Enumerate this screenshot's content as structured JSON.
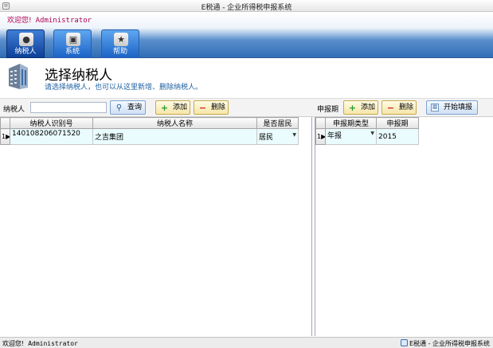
{
  "window": {
    "title": "E税通 - 企业所得税申报系统"
  },
  "banner": {
    "welcome": "欢迎您!",
    "user": "Administrator"
  },
  "nav": {
    "tabs": [
      {
        "label": "纳税人",
        "active": true
      },
      {
        "label": "系统",
        "active": false
      },
      {
        "label": "帮助",
        "active": false
      }
    ]
  },
  "page": {
    "title": "选择纳税人",
    "description": "请选择纳税人，也可以从这里新增、删除纳税人。"
  },
  "toolbar": {
    "taxpayer_label": "纳税人",
    "search_value": "",
    "search_label": "查询",
    "add_label": "添加",
    "delete_label": "删除",
    "period_label": "申报期",
    "period_add_label": "添加",
    "period_delete_label": "删除",
    "start_label": "开始填报"
  },
  "taxpayer_grid": {
    "columns": [
      "纳税人识别号",
      "纳税人名称",
      "是否居民"
    ],
    "rows": [
      {
        "marker": "1▶",
        "id": "140108206071520",
        "name": "之吉集团",
        "resident": "居民"
      }
    ]
  },
  "period_grid": {
    "columns": [
      "申报期类型",
      "申报期"
    ],
    "rows": [
      {
        "marker": "1▶",
        "type": "年报",
        "period": "2015"
      }
    ]
  },
  "status": {
    "welcome": "欢迎您!",
    "user": "Administrator",
    "app_name": "E税通 - 企业所得税申报系统"
  },
  "colors": {
    "banner_blue": "#2f6db7",
    "welcome_text": "#b00050",
    "grid_row": "#eafcfe",
    "button_yellow": "#f5e6a8"
  }
}
